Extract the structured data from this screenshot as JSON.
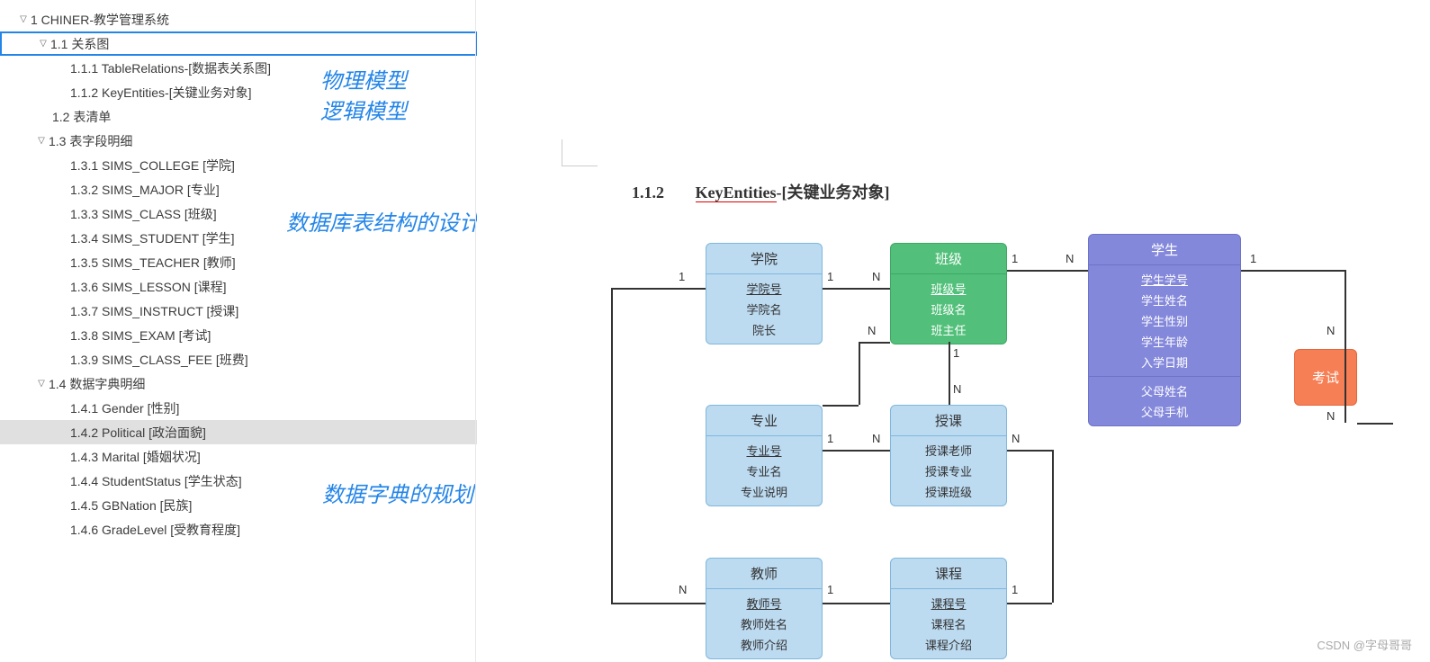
{
  "tree": {
    "root": "1 CHINER-教学管理系统",
    "n11": "1.1 关系图",
    "n111": "1.1.1 TableRelations-[数据表关系图]",
    "n112": "1.1.2 KeyEntities-[关键业务对象]",
    "n12": "1.2 表清单",
    "n13": "1.3 表字段明细",
    "n131": "1.3.1 SIMS_COLLEGE [学院]",
    "n132": "1.3.2 SIMS_MAJOR [专业]",
    "n133": "1.3.3 SIMS_CLASS [班级]",
    "n134": "1.3.4 SIMS_STUDENT [学生]",
    "n135": "1.3.5 SIMS_TEACHER [教师]",
    "n136": "1.3.6 SIMS_LESSON [课程]",
    "n137": "1.3.7 SIMS_INSTRUCT [授课]",
    "n138": "1.3.8 SIMS_EXAM [考试]",
    "n139": "1.3.9 SIMS_CLASS_FEE [班费]",
    "n14": "1.4 数据字典明细",
    "n141": "1.4.1 Gender [性别]",
    "n142": "1.4.2 Political [政治面貌]",
    "n143": "1.4.3 Marital [婚姻状况]",
    "n144": "1.4.4 StudentStatus [学生状态]",
    "n145": "1.4.5 GBNation [民族]",
    "n146": "1.4.6 GradeLevel [受教育程度]"
  },
  "annotations": {
    "a1": "物理模型",
    "a2": "逻辑模型",
    "a3": "数据库表结构的设计",
    "a4": "数据字典的规划"
  },
  "section": {
    "num": "1.1.2",
    "title_key": "KeyEntities",
    "title_rest": "-[关键业务对象]"
  },
  "entities": {
    "college": {
      "name": "学院",
      "pk": "学院号",
      "fields": [
        "学院名",
        "院长"
      ]
    },
    "class": {
      "name": "班级",
      "pk": "班级号",
      "fields": [
        "班级名",
        "班主任"
      ]
    },
    "student": {
      "name": "学生",
      "pk": "学生学号",
      "fields": [
        "学生姓名",
        "学生性别",
        "学生年龄",
        "入学日期"
      ],
      "section2": [
        "父母姓名",
        "父母手机"
      ]
    },
    "exam": {
      "name": "考试"
    },
    "major": {
      "name": "专业",
      "pk": "专业号",
      "fields": [
        "专业名",
        "专业说明"
      ]
    },
    "instruct": {
      "name": "授课",
      "fields": [
        "授课老师",
        "授课专业",
        "授课班级"
      ]
    },
    "teacher": {
      "name": "教师",
      "pk": "教师号",
      "fields": [
        "教师姓名",
        "教师介绍"
      ]
    },
    "lesson": {
      "name": "课程",
      "pk": "课程号",
      "fields": [
        "课程名",
        "课程介绍"
      ]
    }
  },
  "cardinality": {
    "one": "1",
    "many": "N"
  },
  "watermark": "CSDN @字母哥哥"
}
